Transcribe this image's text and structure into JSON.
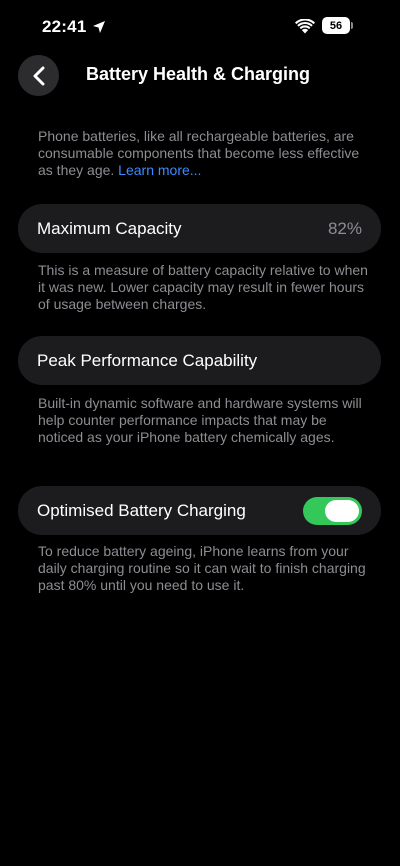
{
  "status_bar": {
    "time": "22:41",
    "battery_level": "56",
    "icons": [
      "location-arrow-icon",
      "wifi-icon",
      "battery-icon"
    ]
  },
  "header": {
    "title": "Battery Health & Charging",
    "back_icon": "chevron-left-icon"
  },
  "intro": {
    "text": "Phone batteries, like all rechargeable batteries, are consumable components that become less effective as they age. ",
    "link": "Learn more..."
  },
  "maximum_capacity": {
    "label": "Maximum Capacity",
    "value": "82%",
    "description": "This is a measure of battery capacity relative to when it was new. Lower capacity may result in fewer hours of usage between charges."
  },
  "peak_performance": {
    "label": "Peak Performance Capability",
    "description": "Built-in dynamic software and hardware systems will help counter performance impacts that may be noticed as your iPhone battery chemically ages."
  },
  "optimised_charging": {
    "label": "Optimised Battery Charging",
    "enabled": true,
    "description": "To reduce battery ageing, iPhone learns from your daily charging routine so it can wait to finish charging past 80% until you need to use it."
  },
  "colors": {
    "background": "#000000",
    "cell": "#1c1c1e",
    "secondary_text": "#8d8d93",
    "link": "#3a8cff",
    "toggle_on": "#34c759"
  }
}
